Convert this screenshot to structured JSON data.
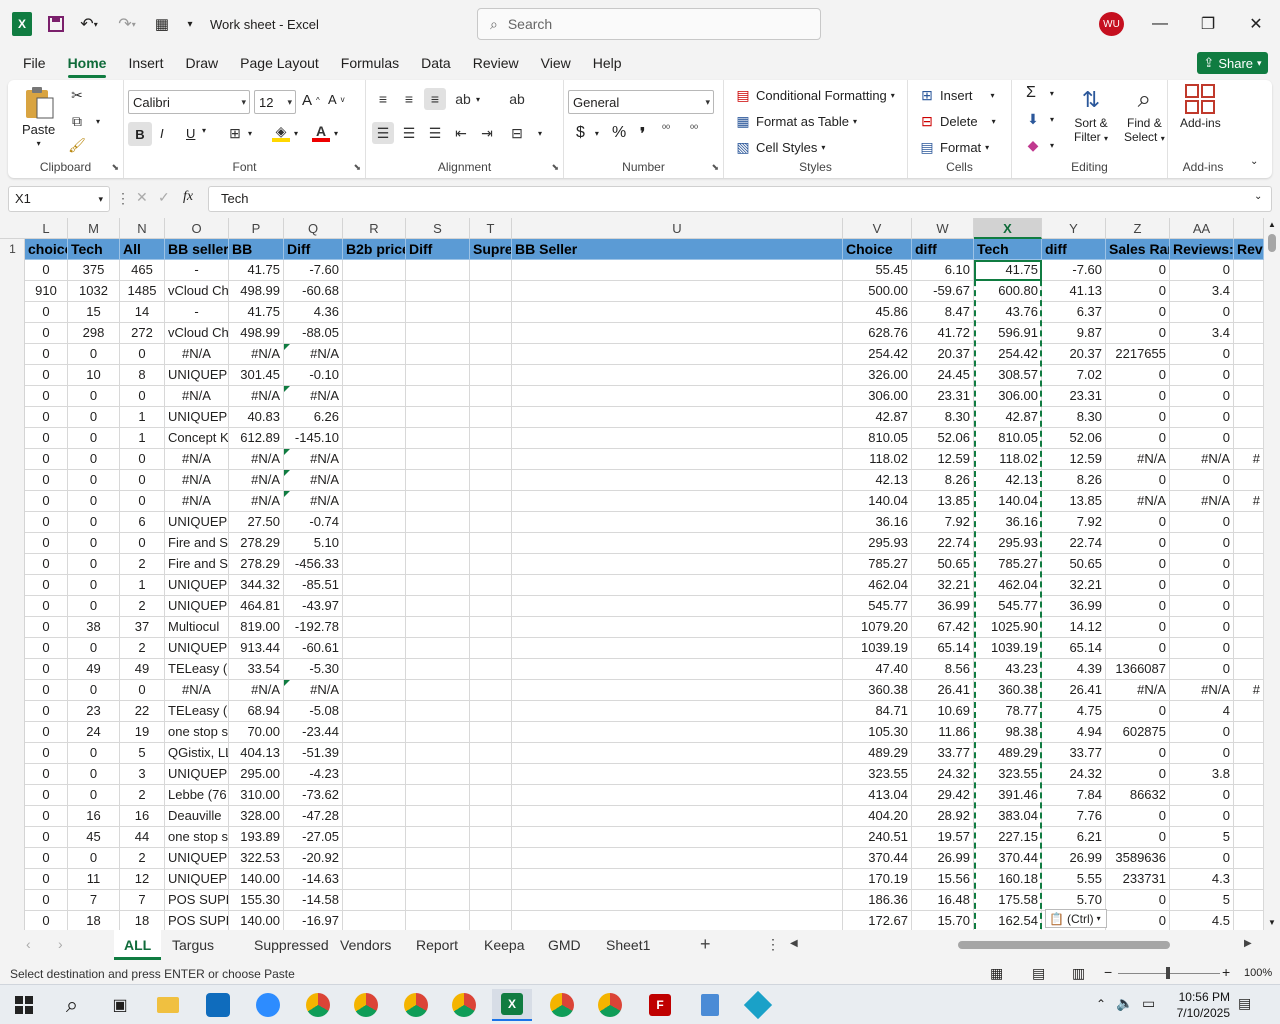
{
  "titlebar": {
    "doc_title": "Work sheet  -  Excel",
    "search_placeholder": "Search",
    "avatar_initials": "WU"
  },
  "ribbon_tabs": [
    "File",
    "Home",
    "Insert",
    "Draw",
    "Page Layout",
    "Formulas",
    "Data",
    "Review",
    "View",
    "Help"
  ],
  "active_ribbon_tab": "Home",
  "share_label": "Share",
  "ribbon": {
    "clipboard": {
      "paste": "Paste",
      "label": "Clipboard"
    },
    "font": {
      "name": "Calibri",
      "size": "12",
      "label": "Font",
      "bold": "B",
      "italic": "I",
      "underline": "U"
    },
    "alignment": {
      "label": "Alignment"
    },
    "number": {
      "format": "General",
      "label": "Number",
      "currency": "$",
      "percent": "%"
    },
    "styles": {
      "conditional": "Conditional Formatting",
      "table": "Format as Table",
      "cell": "Cell Styles",
      "label": "Styles"
    },
    "cells": {
      "insert": "Insert",
      "delete": "Delete",
      "format": "Format",
      "label": "Cells"
    },
    "editing": {
      "sort": "Sort &",
      "sort2": "Filter",
      "find": "Find &",
      "find2": "Select",
      "label": "Editing"
    },
    "addins": {
      "btn": "Add-ins",
      "label": "Add-ins"
    }
  },
  "formula_bar": {
    "name_box": "X1",
    "fx": "fx",
    "value": "Tech"
  },
  "columns": [
    "L",
    "M",
    "N",
    "O",
    "P",
    "Q",
    "R",
    "S",
    "T",
    "U",
    "V",
    "W",
    "X",
    "Y",
    "Z",
    "AA",
    ""
  ],
  "selected_column": "X",
  "header_row": [
    "choice",
    "Tech",
    "All",
    "BB sellers",
    "BB",
    "Diff",
    "B2b price",
    "Diff",
    "Supre",
    "BB Seller",
    "",
    "Choice",
    "diff",
    "Tech",
    "diff",
    "Sales Ran",
    "Reviews:",
    "Rev"
  ],
  "rows": [
    [
      "0",
      "375",
      "465",
      "-",
      "41.75",
      "-7.60",
      "",
      "",
      "",
      "",
      "55.45",
      "6.10",
      "41.75",
      "-7.60",
      "0",
      "0",
      ""
    ],
    [
      "910",
      "1032",
      "1485",
      "vCloud Ch",
      "498.99",
      "-60.68",
      "",
      "",
      "",
      "",
      "500.00",
      "-59.67",
      "600.80",
      "41.13",
      "0",
      "3.4",
      ""
    ],
    [
      "0",
      "15",
      "14",
      "-",
      "41.75",
      "4.36",
      "",
      "",
      "",
      "",
      "45.86",
      "8.47",
      "43.76",
      "6.37",
      "0",
      "0",
      ""
    ],
    [
      "0",
      "298",
      "272",
      "vCloud Ch",
      "498.99",
      "-88.05",
      "",
      "",
      "",
      "",
      "628.76",
      "41.72",
      "596.91",
      "9.87",
      "0",
      "3.4",
      ""
    ],
    [
      "0",
      "0",
      "0",
      "#N/A",
      "#N/A",
      "#N/A",
      "",
      "",
      "",
      "",
      "254.42",
      "20.37",
      "254.42",
      "20.37",
      "2217655",
      "0",
      ""
    ],
    [
      "0",
      "10",
      "8",
      "UNIQUEPC",
      "301.45",
      "-0.10",
      "",
      "",
      "",
      "",
      "326.00",
      "24.45",
      "308.57",
      "7.02",
      "0",
      "0",
      ""
    ],
    [
      "0",
      "0",
      "0",
      "#N/A",
      "#N/A",
      "#N/A",
      "",
      "",
      "",
      "",
      "306.00",
      "23.31",
      "306.00",
      "23.31",
      "0",
      "0",
      ""
    ],
    [
      "0",
      "0",
      "1",
      "UNIQUEPC",
      "40.83",
      "6.26",
      "",
      "",
      "",
      "",
      "42.87",
      "8.30",
      "42.87",
      "8.30",
      "0",
      "0",
      ""
    ],
    [
      "0",
      "0",
      "1",
      "Concept K",
      "612.89",
      "-145.10",
      "",
      "",
      "",
      "",
      "810.05",
      "52.06",
      "810.05",
      "52.06",
      "0",
      "0",
      ""
    ],
    [
      "0",
      "0",
      "0",
      "#N/A",
      "#N/A",
      "#N/A",
      "",
      "",
      "",
      "",
      "118.02",
      "12.59",
      "118.02",
      "12.59",
      "#N/A",
      "#N/A",
      "#"
    ],
    [
      "0",
      "0",
      "0",
      "#N/A",
      "#N/A",
      "#N/A",
      "",
      "",
      "",
      "",
      "42.13",
      "8.26",
      "42.13",
      "8.26",
      "0",
      "0",
      ""
    ],
    [
      "0",
      "0",
      "0",
      "#N/A",
      "#N/A",
      "#N/A",
      "",
      "",
      "",
      "",
      "140.04",
      "13.85",
      "140.04",
      "13.85",
      "#N/A",
      "#N/A",
      "#"
    ],
    [
      "0",
      "0",
      "6",
      "UNIQUEPC",
      "27.50",
      "-0.74",
      "",
      "",
      "",
      "",
      "36.16",
      "7.92",
      "36.16",
      "7.92",
      "0",
      "0",
      ""
    ],
    [
      "0",
      "0",
      "0",
      "Fire and S",
      "278.29",
      "5.10",
      "",
      "",
      "",
      "",
      "295.93",
      "22.74",
      "295.93",
      "22.74",
      "0",
      "0",
      ""
    ],
    [
      "0",
      "0",
      "2",
      "Fire and S",
      "278.29",
      "-456.33",
      "",
      "",
      "",
      "",
      "785.27",
      "50.65",
      "785.27",
      "50.65",
      "0",
      "0",
      ""
    ],
    [
      "0",
      "0",
      "1",
      "UNIQUEPC",
      "344.32",
      "-85.51",
      "",
      "",
      "",
      "",
      "462.04",
      "32.21",
      "462.04",
      "32.21",
      "0",
      "0",
      ""
    ],
    [
      "0",
      "0",
      "2",
      "UNIQUEPC",
      "464.81",
      "-43.97",
      "",
      "",
      "",
      "",
      "545.77",
      "36.99",
      "545.77",
      "36.99",
      "0",
      "0",
      ""
    ],
    [
      "0",
      "38",
      "37",
      "Multiocul",
      "819.00",
      "-192.78",
      "",
      "",
      "",
      "",
      "1079.20",
      "67.42",
      "1025.90",
      "14.12",
      "0",
      "0",
      ""
    ],
    [
      "0",
      "0",
      "2",
      "UNIQUEPC",
      "913.44",
      "-60.61",
      "",
      "",
      "",
      "",
      "1039.19",
      "65.14",
      "1039.19",
      "65.14",
      "0",
      "0",
      ""
    ],
    [
      "0",
      "49",
      "49",
      "TELeasy (6",
      "33.54",
      "-5.30",
      "",
      "",
      "",
      "",
      "47.40",
      "8.56",
      "43.23",
      "4.39",
      "1366087",
      "0",
      ""
    ],
    [
      "0",
      "0",
      "0",
      "#N/A",
      "#N/A",
      "#N/A",
      "",
      "",
      "",
      "",
      "360.38",
      "26.41",
      "360.38",
      "26.41",
      "#N/A",
      "#N/A",
      "#"
    ],
    [
      "0",
      "23",
      "22",
      "TELeasy (6",
      "68.94",
      "-5.08",
      "",
      "",
      "",
      "",
      "84.71",
      "10.69",
      "78.77",
      "4.75",
      "0",
      "4",
      ""
    ],
    [
      "0",
      "24",
      "19",
      "one stop s",
      "70.00",
      "-23.44",
      "",
      "",
      "",
      "",
      "105.30",
      "11.86",
      "98.38",
      "4.94",
      "602875",
      "0",
      ""
    ],
    [
      "0",
      "0",
      "5",
      "QGistix, LL",
      "404.13",
      "-51.39",
      "",
      "",
      "",
      "",
      "489.29",
      "33.77",
      "489.29",
      "33.77",
      "0",
      "0",
      ""
    ],
    [
      "0",
      "0",
      "3",
      "UNIQUEPC",
      "295.00",
      "-4.23",
      "",
      "",
      "",
      "",
      "323.55",
      "24.32",
      "323.55",
      "24.32",
      "0",
      "3.8",
      ""
    ],
    [
      "0",
      "0",
      "2",
      "Lebbe (76",
      "310.00",
      "-73.62",
      "",
      "",
      "",
      "",
      "413.04",
      "29.42",
      "391.46",
      "7.84",
      "86632",
      "0",
      ""
    ],
    [
      "0",
      "16",
      "16",
      "Deauville",
      "328.00",
      "-47.28",
      "",
      "",
      "",
      "",
      "404.20",
      "28.92",
      "383.04",
      "7.76",
      "0",
      "0",
      ""
    ],
    [
      "0",
      "45",
      "44",
      "one stop s",
      "193.89",
      "-27.05",
      "",
      "",
      "",
      "",
      "240.51",
      "19.57",
      "227.15",
      "6.21",
      "0",
      "5",
      ""
    ],
    [
      "0",
      "0",
      "2",
      "UNIQUEPC",
      "322.53",
      "-20.92",
      "",
      "",
      "",
      "",
      "370.44",
      "26.99",
      "370.44",
      "26.99",
      "3589636",
      "0",
      ""
    ],
    [
      "0",
      "11",
      "12",
      "UNIQUEPC",
      "140.00",
      "-14.63",
      "",
      "",
      "",
      "",
      "170.19",
      "15.56",
      "160.18",
      "5.55",
      "233731",
      "4.3",
      ""
    ],
    [
      "0",
      "7",
      "7",
      "POS SUPE",
      "155.30",
      "-14.58",
      "",
      "",
      "",
      "",
      "186.36",
      "16.48",
      "175.58",
      "5.70",
      "0",
      "5",
      ""
    ],
    [
      "0",
      "18",
      "18",
      "POS SUPE",
      "140.00",
      "-16.97",
      "",
      "",
      "",
      "",
      "172.67",
      "15.70",
      "162.54",
      "",
      "0",
      "4.5",
      ""
    ]
  ],
  "paste_options": "(Ctrl)",
  "sheet_tabs": [
    "ALL",
    "Targus",
    "Suppressed",
    "Vendors",
    "Report",
    "Keepa",
    "GMD",
    "Sheet1"
  ],
  "active_sheet": "ALL",
  "status_text": "Select destination and press ENTER or choose Paste",
  "zoom": "100%",
  "clock": {
    "time": "10:56 PM",
    "date": "7/10/2025"
  }
}
